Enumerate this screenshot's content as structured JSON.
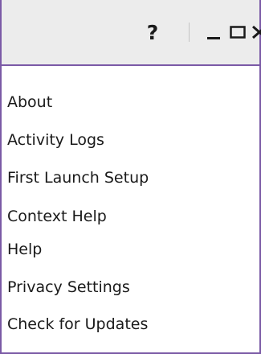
{
  "titlebar": {
    "help_symbol": "?",
    "icons": [
      "question-mark-icon",
      "minimize-icon",
      "maximize-icon",
      "close-icon"
    ]
  },
  "menu": {
    "items": [
      {
        "label": "About"
      },
      {
        "label": "Activity Logs"
      },
      {
        "label": "First Launch Setup"
      },
      {
        "label": "Context Help"
      },
      {
        "label": "Help"
      },
      {
        "label": "Privacy Settings"
      },
      {
        "label": "Check for Updates"
      }
    ]
  },
  "colors": {
    "accent_border": "#7b5aa6",
    "titlebar_bg": "#ececec",
    "text": "#1a1a1a"
  }
}
